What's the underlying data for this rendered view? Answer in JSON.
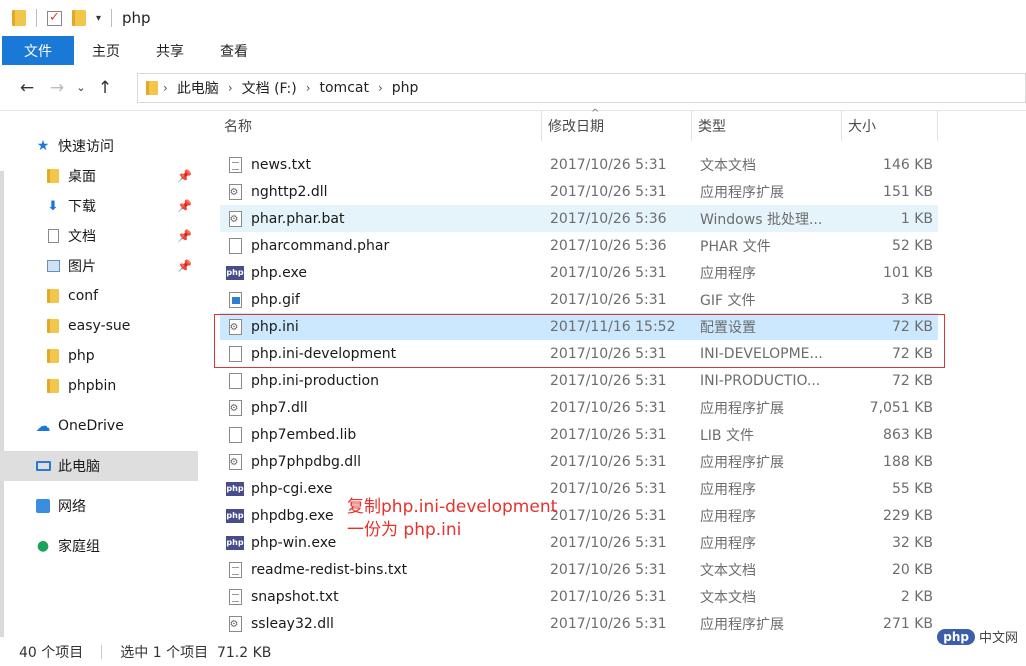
{
  "window": {
    "title": "php"
  },
  "ribbon": {
    "tabs": [
      "文件",
      "主页",
      "共享",
      "查看"
    ]
  },
  "address": {
    "crumbs": [
      "此电脑",
      "文档 (F:)",
      "tomcat",
      "php"
    ]
  },
  "nav": {
    "items": [
      {
        "label": "快速访问",
        "icon": "star-icon"
      },
      {
        "label": "桌面",
        "icon": "folder-icon",
        "pinned": true
      },
      {
        "label": "下载",
        "icon": "download-icon",
        "pinned": true
      },
      {
        "label": "文档",
        "icon": "document-icon",
        "pinned": true
      },
      {
        "label": "图片",
        "icon": "picture-icon",
        "pinned": true
      },
      {
        "label": "conf",
        "icon": "folder-icon"
      },
      {
        "label": "easy-sue",
        "icon": "folder-icon"
      },
      {
        "label": "php",
        "icon": "folder-icon"
      },
      {
        "label": "phpbin",
        "icon": "folder-icon"
      },
      {
        "label": "OneDrive",
        "icon": "cloud-icon"
      },
      {
        "label": "此电脑",
        "icon": "computer-icon",
        "selected": true
      },
      {
        "label": "网络",
        "icon": "network-icon"
      },
      {
        "label": "家庭组",
        "icon": "homegroup-icon"
      }
    ]
  },
  "columns": {
    "name": "名称",
    "date": "修改日期",
    "type": "类型",
    "size": "大小"
  },
  "files": [
    {
      "name": "news.txt",
      "date": "2017/10/26 5:31",
      "type": "文本文档",
      "size": "146 KB",
      "icon": "txt"
    },
    {
      "name": "nghttp2.dll",
      "date": "2017/10/26 5:31",
      "type": "应用程序扩展",
      "size": "151 KB",
      "icon": "dll"
    },
    {
      "name": "phar.phar.bat",
      "date": "2017/10/26 5:36",
      "type": "Windows 批处理...",
      "size": "1 KB",
      "icon": "dll",
      "state": "hover"
    },
    {
      "name": "pharcommand.phar",
      "date": "2017/10/26 5:36",
      "type": "PHAR 文件",
      "size": "52 KB",
      "icon": "blank"
    },
    {
      "name": "php.exe",
      "date": "2017/10/26 5:31",
      "type": "应用程序",
      "size": "101 KB",
      "icon": "php"
    },
    {
      "name": "php.gif",
      "date": "2017/10/26 5:31",
      "type": "GIF 文件",
      "size": "3 KB",
      "icon": "gif"
    },
    {
      "name": "php.ini",
      "date": "2017/11/16 15:52",
      "type": "配置设置",
      "size": "72 KB",
      "icon": "dll",
      "state": "selected"
    },
    {
      "name": "php.ini-development",
      "date": "2017/10/26 5:31",
      "type": "INI-DEVELOPME...",
      "size": "72 KB",
      "icon": "blank"
    },
    {
      "name": "php.ini-production",
      "date": "2017/10/26 5:31",
      "type": "INI-PRODUCTIO...",
      "size": "72 KB",
      "icon": "blank"
    },
    {
      "name": "php7.dll",
      "date": "2017/10/26 5:31",
      "type": "应用程序扩展",
      "size": "7,051 KB",
      "icon": "dll"
    },
    {
      "name": "php7embed.lib",
      "date": "2017/10/26 5:31",
      "type": "LIB 文件",
      "size": "863 KB",
      "icon": "blank"
    },
    {
      "name": "php7phpdbg.dll",
      "date": "2017/10/26 5:31",
      "type": "应用程序扩展",
      "size": "188 KB",
      "icon": "dll"
    },
    {
      "name": "php-cgi.exe",
      "date": "2017/10/26 5:31",
      "type": "应用程序",
      "size": "55 KB",
      "icon": "php"
    },
    {
      "name": "phpdbg.exe",
      "date": "2017/10/26 5:31",
      "type": "应用程序",
      "size": "229 KB",
      "icon": "php"
    },
    {
      "name": "php-win.exe",
      "date": "2017/10/26 5:31",
      "type": "应用程序",
      "size": "32 KB",
      "icon": "php"
    },
    {
      "name": "readme-redist-bins.txt",
      "date": "2017/10/26 5:31",
      "type": "文本文档",
      "size": "20 KB",
      "icon": "txt"
    },
    {
      "name": "snapshot.txt",
      "date": "2017/10/26 5:31",
      "type": "文本文档",
      "size": "2 KB",
      "icon": "txt"
    },
    {
      "name": "ssleay32.dll",
      "date": "2017/10/26 5:31",
      "type": "应用程序扩展",
      "size": "271 KB",
      "icon": "dll"
    }
  ],
  "annotation": {
    "line1": "复制php.ini-development",
    "line2": "一份为 php.ini"
  },
  "status": {
    "count": "40 个项目",
    "selection": "选中 1 个项目  71.2 KB"
  },
  "watermark": {
    "logo": "php",
    "text": "中文网"
  }
}
